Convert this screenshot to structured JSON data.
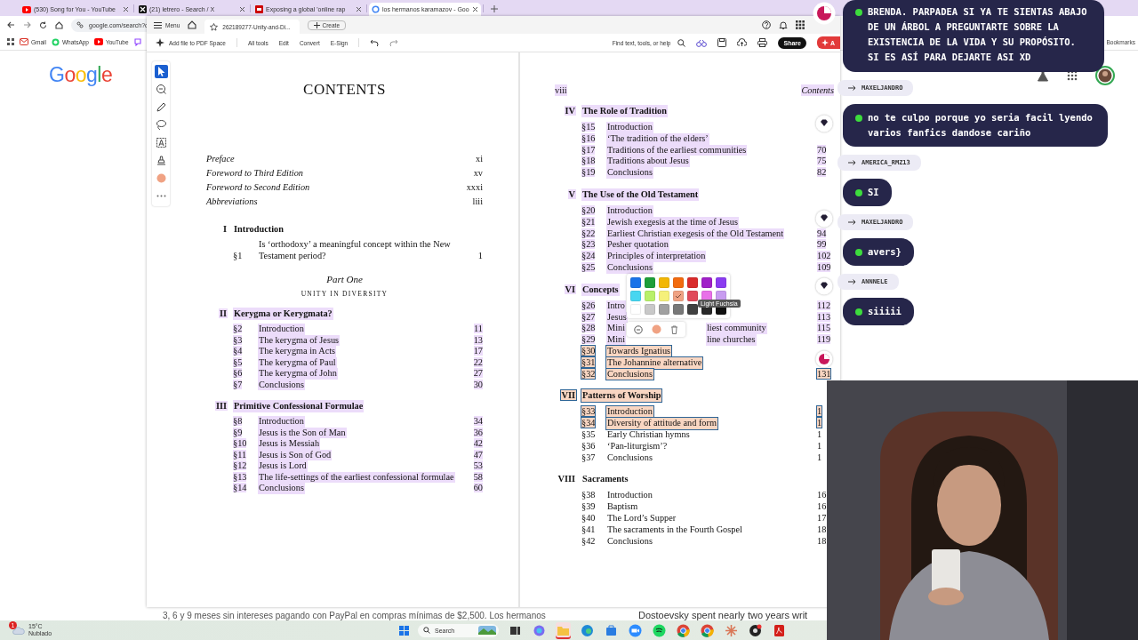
{
  "browser": {
    "tabs": [
      {
        "title": "(530) Song for You - YouTube",
        "kind": "youtube",
        "selected": false
      },
      {
        "title": "(21) letrero - Search / X",
        "kind": "x",
        "selected": false
      },
      {
        "title": "Exposing a global 'online rap",
        "kind": "news",
        "selected": false
      },
      {
        "title": "los hermanos karamazov - Goo",
        "kind": "google",
        "selected": true
      }
    ],
    "address": "google.com/search?q",
    "bookmarks": [
      {
        "label": "Gmail",
        "kind": "gmail"
      },
      {
        "label": "WhatsApp",
        "kind": "whatsapp"
      },
      {
        "label": "YouTube",
        "kind": "youtube"
      }
    ],
    "bookmarks_folder": "Bookmarks"
  },
  "search_page": {
    "logo": "Google",
    "footer_left": "3, 6 y 9 meses sin intereses pagando con PayPal en compras mínimas de $2,500. Los hermanos",
    "footer_right": "Dostoevsky spent nearly two years writ"
  },
  "acrobat": {
    "menu": "Menu",
    "document_tab": "262189277-Unity-and-Di...",
    "create": "Create",
    "toolbar": {
      "add_file": "Add file to PDF Space",
      "tools": [
        "All tools",
        "Edit",
        "Convert",
        "E-Sign"
      ],
      "search_placeholder": "Find text, tools, or help",
      "share": "Share",
      "ai": "A"
    },
    "tool_rail": [
      {
        "kind": "select",
        "selected": true
      },
      {
        "kind": "comment",
        "selected": false
      },
      {
        "kind": "pen",
        "selected": false
      },
      {
        "kind": "lasso",
        "selected": false
      },
      {
        "kind": "text",
        "selected": false
      },
      {
        "kind": "stamp",
        "selected": false
      },
      {
        "kind": "color",
        "selected": false
      },
      {
        "kind": "more",
        "selected": false
      }
    ],
    "left_page": {
      "title": "CONTENTS",
      "front_matter": [
        {
          "title": "Preface",
          "page": "xi"
        },
        {
          "title": "Foreword to Third Edition",
          "page": "xv"
        },
        {
          "title": "Foreword to Second Edition",
          "page": "xxxi"
        },
        {
          "title": "Abbreviations",
          "page": "liii"
        }
      ],
      "blocks": [
        {
          "kind": "chapter",
          "numeral": "I",
          "title": "Introduction",
          "sections": [
            {
              "number": "§1",
              "title": "Is ‘orthodoxy’ a meaningful concept within the New Testament period?",
              "page": "1"
            }
          ]
        },
        {
          "kind": "part",
          "label": "Part One",
          "title": "UNITY IN DIVERSITY"
        },
        {
          "kind": "chapter",
          "numeral": "II",
          "title": "Kerygma or Kerygmata?",
          "color": "#ecdcfa",
          "sections": [
            {
              "number": "§2",
              "title": "Introduction",
              "page": "11",
              "color": "#ecdcfa"
            },
            {
              "number": "§3",
              "title": "The kerygma of Jesus",
              "page": "13",
              "color": "#ecdcfa"
            },
            {
              "number": "§4",
              "title": "The kerygma in Acts",
              "page": "17",
              "color": "#ecdcfa"
            },
            {
              "number": "§5",
              "title": "The kerygma of Paul",
              "page": "22",
              "color": "#ecdcfa"
            },
            {
              "number": "§6",
              "title": "The kerygma of John",
              "page": "27",
              "color": "#ecdcfa"
            },
            {
              "number": "§7",
              "title": "Conclusions",
              "page": "30",
              "color": "#ecdcfa"
            }
          ]
        },
        {
          "kind": "chapter",
          "numeral": "III",
          "title": "Primitive Confessional Formulae",
          "color": "#ecdcfa",
          "sections": [
            {
              "number": "§8",
              "title": "Introduction",
              "page": "34",
              "color": "#ecdcfa"
            },
            {
              "number": "§9",
              "title": "Jesus is the Son of Man",
              "page": "36",
              "color": "#ecdcfa"
            },
            {
              "number": "§10",
              "title": "Jesus is Messiah",
              "page": "42",
              "color": "#ecdcfa"
            },
            {
              "number": "§11",
              "title": "Jesus is Son of God",
              "page": "47",
              "color": "#ecdcfa"
            },
            {
              "number": "§12",
              "title": "Jesus is Lord",
              "page": "53",
              "color": "#ecdcfa"
            },
            {
              "number": "§13",
              "title": "The life-settings of the earliest confessional formulae",
              "page": "58",
              "color": "#ecdcfa"
            },
            {
              "number": "§14",
              "title": "Conclusions",
              "page": "60",
              "color": "#ecdcfa"
            }
          ]
        }
      ]
    },
    "right_page": {
      "folio": "viii",
      "running_title": "Contents",
      "color": "#ecdcfa",
      "chapters": [
        {
          "numeral": "IV",
          "title": "The Role of Tradition",
          "color": "#ecdcfa",
          "selected": false,
          "sections": [
            {
              "number": "§15",
              "title": "Introduction",
              "color": "#ecdcfa",
              "selected": false,
              "marker": {
                "kind": "comment"
              }
            },
            {
              "number": "§16",
              "title": "‘The tradition of the elders’",
              "color": "#ecdcfa",
              "selected": false
            },
            {
              "number": "§17",
              "title": "Traditions of the earliest communities",
              "page": "70",
              "color": "#ecdcfa",
              "selected": false
            },
            {
              "number": "§18",
              "title": "Traditions about Jesus",
              "page": "75",
              "color": "#ecdcfa",
              "selected": false
            },
            {
              "number": "§19",
              "title": "Conclusions",
              "page": "82",
              "color": "#ecdcfa",
              "selected": false
            }
          ]
        },
        {
          "numeral": "V",
          "title": "The Use of the Old Testament",
          "color": "#ecdcfa",
          "selected": false,
          "sections": [
            {
              "number": "§20",
              "title": "Introduction",
              "color": "#ecdcfa",
              "selected": false
            },
            {
              "number": "§21",
              "title": "Jewish exegesis at the time of Jesus",
              "color": "#ecdcfa",
              "selected": false,
              "marker": {
                "kind": "comment"
              }
            },
            {
              "number": "§22",
              "title": "Earliest Christian exegesis of the Old Testament",
              "page": "94",
              "color": "#ecdcfa",
              "selected": false
            },
            {
              "number": "§23",
              "title": "Pesher quotation",
              "page": "99",
              "color": "#ecdcfa",
              "selected": false
            },
            {
              "number": "§24",
              "title": "Principles of interpretation",
              "page": "102",
              "color": "#ecdcfa",
              "selected": false
            },
            {
              "number": "§25",
              "title": "Conclusions",
              "page": "109",
              "color": "#ecdcfa",
              "selected": false
            }
          ]
        },
        {
          "numeral": "VI",
          "title": "Concepts",
          "color": "#ecdcfa",
          "selected": false,
          "marker": {
            "kind": "comment"
          },
          "sections": [
            {
              "number": "§26",
              "title": "Intro",
              "page": "112",
              "color": "#ecdcfa",
              "selected": false
            },
            {
              "number": "§27",
              "title": "Jesus",
              "page": "113",
              "color": "#ecdcfa",
              "selected": false
            },
            {
              "number": "§28",
              "title": "Mini",
              "tail": "liest community",
              "page": "115",
              "color": "#ecdcfa",
              "selected": false
            },
            {
              "number": "§29",
              "title": "Mini",
              "tail": "line churches",
              "page": "119",
              "color": "#ecdcfa",
              "selected": false
            },
            {
              "number": "§30",
              "title": "Towards Ignatius",
              "color": "#f9d6c2",
              "selected": true
            },
            {
              "number": "§31",
              "title": "The Johannine alternative",
              "color": "#f9d6c2",
              "selected": true,
              "marker": {
                "kind": "active"
              }
            },
            {
              "number": "§32",
              "title": "Conclusions",
              "page": "131",
              "color": "#f9d6c2",
              "selected": true
            }
          ]
        },
        {
          "numeral": "VII",
          "title": "Patterns of Worship",
          "color": "#f9d6c2",
          "selected": true,
          "sections": [
            {
              "number": "§33",
              "title": "Introduction",
              "page": "1",
              "color": "#f9d6c2",
              "selected": true
            },
            {
              "number": "§34",
              "title": "Diversity of attitude and form",
              "page": "1",
              "color": "#f9d6c2",
              "selected": true
            },
            {
              "number": "§35",
              "title": "Early Christian hymns",
              "page": "1",
              "selected": false
            },
            {
              "number": "§36",
              "title": "‘Pan-liturgism’?",
              "page": "1",
              "selected": false
            },
            {
              "number": "§37",
              "title": "Conclusions",
              "page": "1",
              "selected": false
            }
          ]
        },
        {
          "numeral": "VIII",
          "title": "Sacraments",
          "selected": false,
          "sections": [
            {
              "number": "§38",
              "title": "Introduction",
              "page": "16",
              "selected": false
            },
            {
              "number": "§39",
              "title": "Baptism",
              "page": "16",
              "selected": false
            },
            {
              "number": "§40",
              "title": "The Lord’s Supper",
              "page": "17",
              "selected": false
            },
            {
              "number": "§41",
              "title": "The sacraments in the Fourth Gospel",
              "page": "18",
              "selected": false
            },
            {
              "number": "§42",
              "title": "Conclusions",
              "page": "18",
              "selected": false
            }
          ]
        }
      ]
    },
    "color_picker": {
      "tooltip": "Light Fuchsia",
      "color": "#f0a283",
      "swatches": [
        {
          "color": "#1a73e8",
          "selected": false
        },
        {
          "color": "#1e9e3a",
          "selected": false
        },
        {
          "color": "#f2b705",
          "selected": false
        },
        {
          "color": "#f26b0f",
          "selected": false
        },
        {
          "color": "#d92b2b",
          "selected": false
        },
        {
          "color": "#a020c8",
          "selected": false
        },
        {
          "color": "#8a3cf0",
          "selected": false
        },
        {
          "color": "#47d6f0",
          "selected": false
        },
        {
          "color": "#b8f06a",
          "selected": false
        },
        {
          "color": "#f5f07a",
          "selected": false
        },
        {
          "color": "#f0a283",
          "selected": true
        },
        {
          "color": "#e04a5a",
          "selected": false
        },
        {
          "color": "#e870e8",
          "selected": false
        },
        {
          "color": "#c89cf0",
          "selected": false
        },
        {
          "color": "#ffffff",
          "selected": false
        },
        {
          "color": "#c8c8c8",
          "selected": false
        },
        {
          "color": "#a0a0a0",
          "selected": false
        },
        {
          "color": "#787878",
          "selected": false
        },
        {
          "color": "#404040",
          "selected": false
        },
        {
          "color": "#282828",
          "selected": false
        },
        {
          "color": "#101010",
          "selected": false
        }
      ]
    }
  },
  "chat": [
    {
      "kind": "message",
      "text": "BRENDA. PARPADEA SI YA TE SIENTAS ABAJO DE UN ÁRBOL A PREGUNTARTE SOBRE LA EXISTENCIA DE LA VIDA Y SU PROPÓSITO. SI ES ASÍ PARA DEJARTE ASI XD"
    },
    {
      "kind": "user",
      "text": "MAXELJANDRO"
    },
    {
      "kind": "message",
      "text": "no te culpo porque yo seria facil lyendo varios fanfics dandose cariño"
    },
    {
      "kind": "user",
      "text": "AMERICA_RMZ13"
    },
    {
      "kind": "message",
      "text": "SI"
    },
    {
      "kind": "user",
      "text": "MAXELJANDRO"
    },
    {
      "kind": "message",
      "text": "avers}"
    },
    {
      "kind": "user",
      "text": "ANNNELE"
    },
    {
      "kind": "message",
      "text": "siiiii"
    }
  ],
  "taskbar": {
    "weather": {
      "badge": "1",
      "temp": "15°C",
      "condition": "Nublado"
    },
    "search": "Search",
    "apps": [
      {
        "kind": "taskview",
        "selected": false
      },
      {
        "kind": "copilot",
        "selected": false
      },
      {
        "kind": "folder",
        "selected": true
      },
      {
        "kind": "edge",
        "selected": false
      },
      {
        "kind": "store",
        "selected": false
      },
      {
        "kind": "zoom",
        "selected": false
      },
      {
        "kind": "spotify",
        "selected": false
      },
      {
        "kind": "chrome",
        "selected": false
      },
      {
        "kind": "chrome",
        "selected": false
      },
      {
        "kind": "burst",
        "selected": false
      },
      {
        "kind": "obs",
        "selected": false
      },
      {
        "kind": "pdf",
        "selected": false
      }
    ]
  }
}
